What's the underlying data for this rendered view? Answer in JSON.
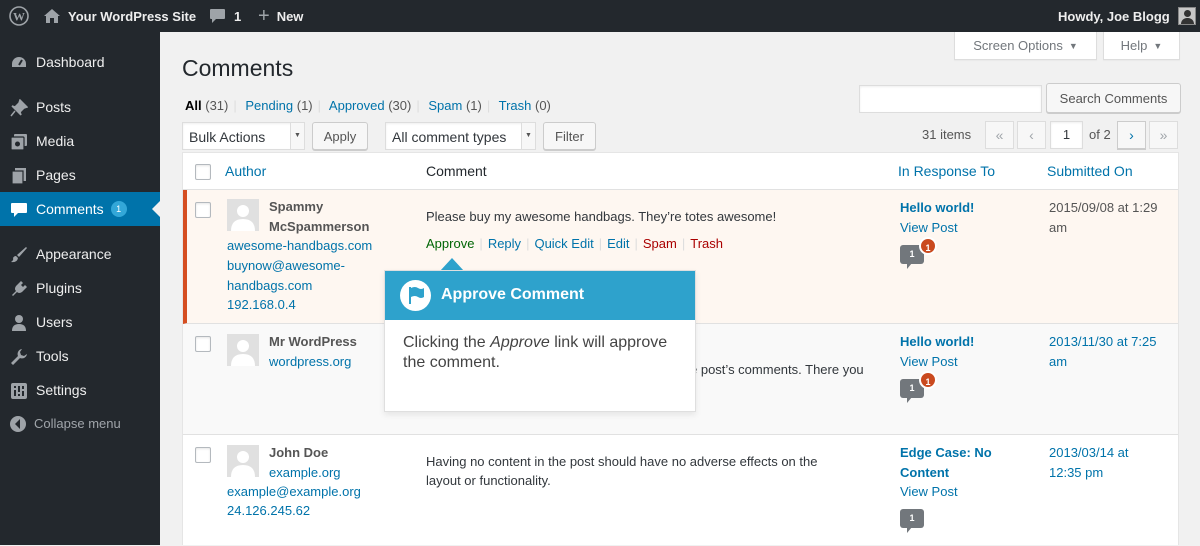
{
  "admin_bar": {
    "site_name": "Your WordPress Site",
    "comment_count": "1",
    "new_label": "New",
    "howdy": "Howdy, Joe Blogg"
  },
  "sidebar": {
    "items": [
      {
        "label": "Dashboard",
        "icon": "dashboard-icon"
      },
      {
        "label": "Posts",
        "icon": "pin-icon"
      },
      {
        "label": "Media",
        "icon": "media-icon"
      },
      {
        "label": "Pages",
        "icon": "pages-icon"
      },
      {
        "label": "Comments",
        "icon": "comment-icon",
        "badge": "1",
        "current": true
      },
      {
        "label": "Appearance",
        "icon": "brush-icon"
      },
      {
        "label": "Plugins",
        "icon": "plugin-icon"
      },
      {
        "label": "Users",
        "icon": "user-icon"
      },
      {
        "label": "Tools",
        "icon": "wrench-icon"
      },
      {
        "label": "Settings",
        "icon": "settings-icon"
      }
    ],
    "collapse_label": "Collapse menu"
  },
  "screen_meta": {
    "screen_options": "Screen Options",
    "help": "Help"
  },
  "page": {
    "title": "Comments"
  },
  "filters": {
    "all": {
      "label": "All",
      "count": "(31)"
    },
    "pending": {
      "label": "Pending",
      "count": "(1)"
    },
    "approved": {
      "label": "Approved",
      "count": "(30)"
    },
    "spam": {
      "label": "Spam",
      "count": "(1)"
    },
    "trash": {
      "label": "Trash",
      "count": "(0)"
    }
  },
  "search": {
    "value": "",
    "button": "Search Comments"
  },
  "toolbar": {
    "bulk_actions": "Bulk Actions",
    "apply": "Apply",
    "comment_types": "All comment types",
    "filter": "Filter",
    "items_count": "31 items",
    "first": "«",
    "prev": "‹",
    "current_page": "1",
    "of_pages": "of 2",
    "next": "›",
    "last": "»"
  },
  "table": {
    "columns": {
      "author": "Author",
      "comment": "Comment",
      "in_response_to": "In Response To",
      "submitted_on": "Submitted On"
    },
    "rows": [
      {
        "author_name_1": "Spammy",
        "author_name_2": "McSpammerson",
        "url": "awesome-handbags.com",
        "email_1": "buynow@awesome-",
        "email_2": "handbags.com",
        "ip": "192.168.0.4",
        "comment": "Please buy my awesome handbags. They’re totes awesome!",
        "actions": {
          "approve": "Approve",
          "reply": "Reply",
          "quick_edit": "Quick Edit",
          "edit": "Edit",
          "spam": "Spam",
          "trash": "Trash"
        },
        "post_title": "Hello world!",
        "view_post": "View Post",
        "approved_count": "1",
        "pending_count": "1",
        "date_1": "2015/09/08 at 1:29",
        "date_2": "am"
      },
      {
        "author_name": "Mr WordPress",
        "url": "wordpress.org",
        "comment_partial": "e post’s comments. There you",
        "post_title": "Hello world!",
        "view_post": "View Post",
        "approved_count": "1",
        "pending_count": "1",
        "date_1": "2013/11/30 at 7:25",
        "date_2": "am"
      },
      {
        "author_name": "John Doe",
        "url": "example.org",
        "email": "example@example.org",
        "ip": "24.126.245.62",
        "comment_1": "Having no content in the post should have no adverse effects on the",
        "comment_2": "layout or functionality.",
        "post_title_1": "Edge Case: No",
        "post_title_2": "Content",
        "view_post": "View Post",
        "approved_count": "1",
        "date_1": "2013/03/14 at",
        "date_2": "12:35 pm"
      }
    ]
  },
  "pointer": {
    "title": "Approve Comment",
    "body_before": "Clicking the ",
    "body_em": "Approve",
    "body_after": " link will approve the comment."
  },
  "colors": {
    "admin_bar": "#23282d",
    "accent": "#0073aa",
    "pointer_header": "#2ea2cc",
    "unapproved_border": "#d54e21",
    "pending_badge": "#ca4a1f"
  }
}
